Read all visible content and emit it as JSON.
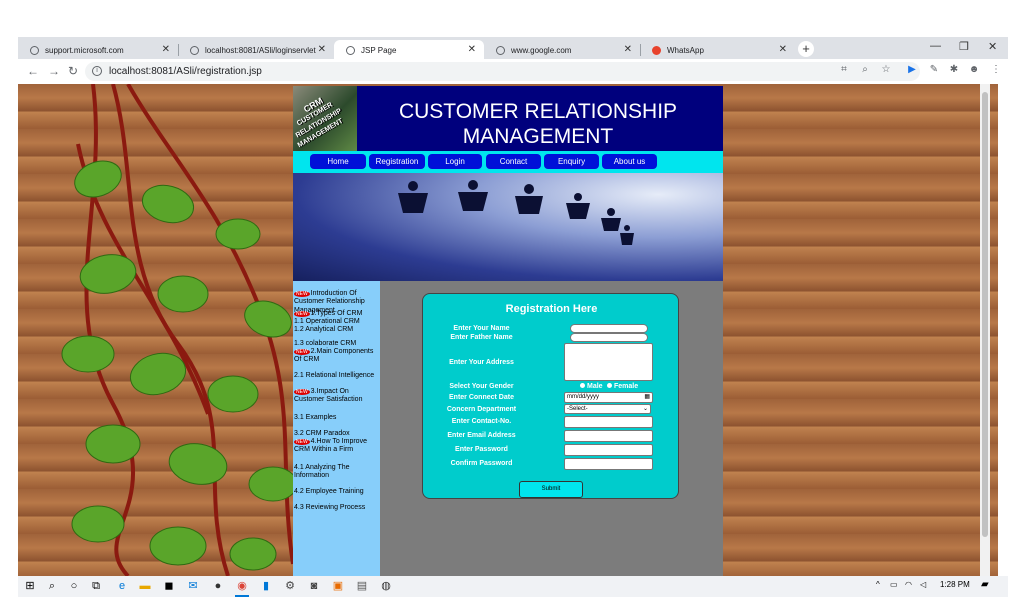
{
  "browser": {
    "tabs": [
      {
        "label": "support.microsoft.com",
        "icon": "globe-icon"
      },
      {
        "label": "localhost:8081/ASli/loginservlet",
        "icon": "globe-icon"
      },
      {
        "label": "JSP Page",
        "icon": "globe-icon",
        "active": true
      },
      {
        "label": "www.google.com",
        "icon": "globe-icon"
      },
      {
        "label": "WhatsApp",
        "icon": "whatsapp-alert-icon"
      }
    ],
    "url": "localhost:8081/ASli/registration.jsp"
  },
  "site": {
    "logo_text": "CRM CUSTOMER RELATIONSHIP MANAGEMENT",
    "title_line1": "CUSTOMER RELATIONSHIP",
    "title_line2": "MANAGEMENT",
    "nav": [
      "Home",
      "Registration",
      "Login",
      "Contact",
      "Enquiry",
      "About us"
    ]
  },
  "sidebar": [
    {
      "text": "Introduction Of Customer Relationship Management.",
      "new": true
    },
    {
      "text": "1.Types Of CRM",
      "new": true
    },
    {
      "text": "1.1 Operational CRM",
      "new": false
    },
    {
      "text": "1.2 Analytical CRM",
      "new": false
    },
    {
      "text": "1.3 colaborate CRM",
      "new": false
    },
    {
      "text": "2.Main Components Of CRM",
      "new": true
    },
    {
      "text": "2.1 Relational Intelligence",
      "new": false
    },
    {
      "text": "3.Impact On Customer Satisfaction",
      "new": true
    },
    {
      "text": "3.1 Examples",
      "new": false
    },
    {
      "text": "3.2 CRM Paradox",
      "new": false
    },
    {
      "text": "4.How To Improve CRM Within a Firm",
      "new": true
    },
    {
      "text": "4.1 Analyzing The Information",
      "new": false
    },
    {
      "text": "4.2 Employee Training",
      "new": false
    },
    {
      "text": "4.3 Reviewing Process",
      "new": false
    }
  ],
  "new_badge": "NEW",
  "form": {
    "title": "Registration Here",
    "labels": {
      "name": "Enter Your Name",
      "father": "Enter Father Name",
      "address": "Enter Your Address",
      "gender": "Select Your Gender",
      "date": "Enter Connect Date",
      "department": "Concern Department",
      "contact": "Enter Contact-No.",
      "email": "Enter Email Address",
      "password": "Enter Password",
      "confirm": "Confirm Password"
    },
    "gender_options": [
      "Male",
      "Female"
    ],
    "date_placeholder": "mm/dd/yyyy",
    "department_selected": "-Select-",
    "submit": "Submit"
  },
  "taskbar": {
    "time": "1:28 PM"
  }
}
